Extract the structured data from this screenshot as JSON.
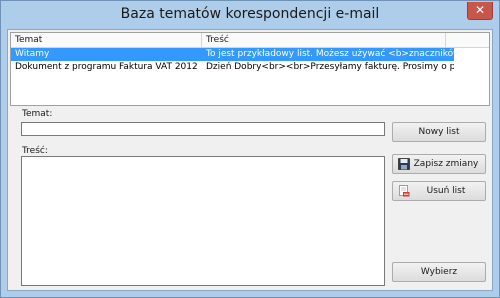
{
  "window": {
    "title": "Baza tematów korespondencji e-mail",
    "close_glyph": "✕"
  },
  "list": {
    "columns": [
      "Temat",
      "Treść"
    ],
    "rows": [
      {
        "temat": "Witamy",
        "tresc": "To jest przykładowy list. Możesz używać <b>znaczników ...",
        "selected": true
      },
      {
        "temat": "Dokument z programu Faktura VAT 2012",
        "tresc": "Dzień Dobry<br><br>Przesyłamy fakturę. Prosimy o potwie...",
        "selected": false
      }
    ]
  },
  "form": {
    "temat_label": "Temat:",
    "temat_value": "",
    "tresc_label": "Treść:",
    "tresc_value": ""
  },
  "buttons": {
    "new": "Nowy list",
    "save": "Zapisz zmiany",
    "delete": "Usuń list",
    "select": "Wybierz"
  },
  "icons": {
    "save": "floppy-disk-icon",
    "delete": "delete-document-icon"
  },
  "colors": {
    "selection": "#3399ff",
    "titlebar": "#aecdea",
    "close": "#c7574c"
  }
}
